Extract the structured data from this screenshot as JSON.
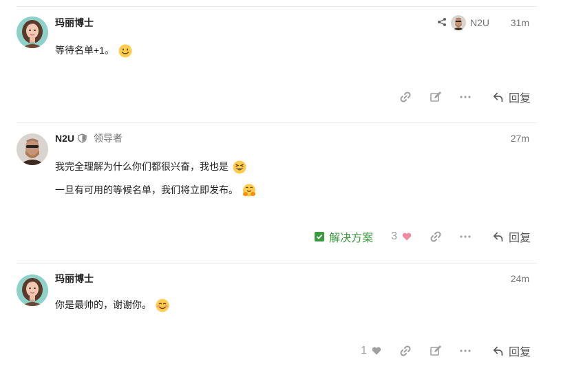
{
  "posts": [
    {
      "author": "玛丽博士",
      "time": "31m",
      "reply_to": {
        "name": "N2U"
      },
      "lines": [
        "等待名单+1。"
      ],
      "emojis": [
        "slightly-smiling-face"
      ],
      "actions": {
        "reply_label": "回复"
      }
    },
    {
      "author": "N2U",
      "role": "领导者",
      "time": "27m",
      "lines": [
        "我完全理解为什么你们都很兴奋，我也是",
        "一旦有可用的等候名单，我们将立即发布。"
      ],
      "emojis": [
        "grinning-squinting-face",
        "hugging-face"
      ],
      "actions": {
        "solution_label": "解决方案",
        "like_count": "3",
        "reply_label": "回复"
      }
    },
    {
      "author": "玛丽博士",
      "time": "24m",
      "lines": [
        "你是最帅的，谢谢你。"
      ],
      "emojis": [
        "smiling-face-with-smiling-eyes"
      ],
      "actions": {
        "like_count": "1",
        "reply_label": "回复"
      }
    }
  ],
  "colors": {
    "solution_green": "#3c9a3f",
    "like_heart": "#f28ba1",
    "separator": "#e9e9e9",
    "muted": "#9e9e9e"
  }
}
